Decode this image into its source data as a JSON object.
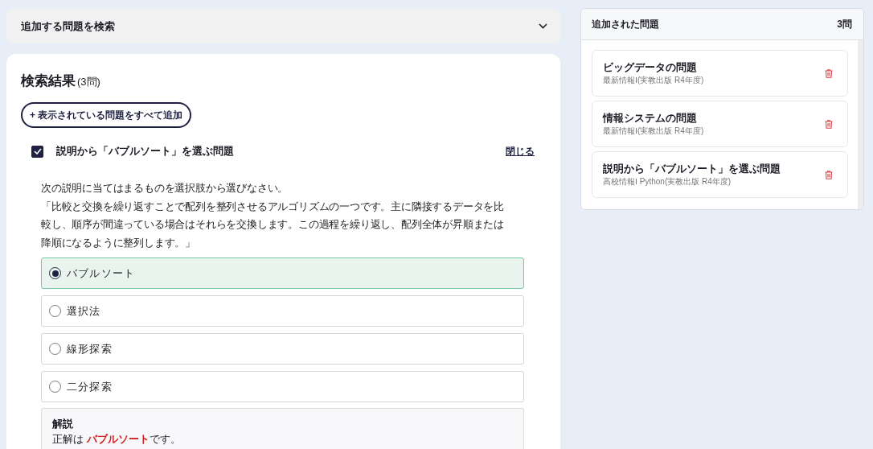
{
  "search_panel": {
    "title": "追加する問題を検索",
    "expanded": false
  },
  "results": {
    "title": "検索結果",
    "count": "(3問)",
    "add_all_button": "+ 表示されている問題をすべて追加",
    "question": {
      "checked": true,
      "title": "説明から「バブルソート」を選ぶ問題",
      "close_link": "閉じる",
      "prompt": [
        "次の説明に当てはまるものを選択肢から選びなさい。",
        "「比較と交換を繰り返すことで配列を整列させるアルゴリズムの一つです。主に隣接するデータを比較し、順序が間違っている場合はそれらを交換します。この過程を繰り返し、配列全体が昇順または降順になるように整列します。」"
      ],
      "options": [
        {
          "label": "バブルソート",
          "selected": true
        },
        {
          "label": "選択法",
          "selected": false
        },
        {
          "label": "線形探索",
          "selected": false
        },
        {
          "label": "二分探索",
          "selected": false
        }
      ],
      "explanation": {
        "title": "解説",
        "text": "正解は **バブルソート**です。"
      }
    }
  },
  "added": {
    "title": "追加された問題",
    "count": "3問",
    "items": [
      {
        "title": "ビッグデータの問題",
        "source": "最新情報Ⅰ(実教出版 R4年度)"
      },
      {
        "title": "情報システムの問題",
        "source": "最新情報Ⅰ(実教出版 R4年度)"
      },
      {
        "title": "説明から「バブルソート」を選ぶ問題",
        "source": "高校情報Ⅰ Python(実教出版 R4年度)"
      }
    ]
  }
}
